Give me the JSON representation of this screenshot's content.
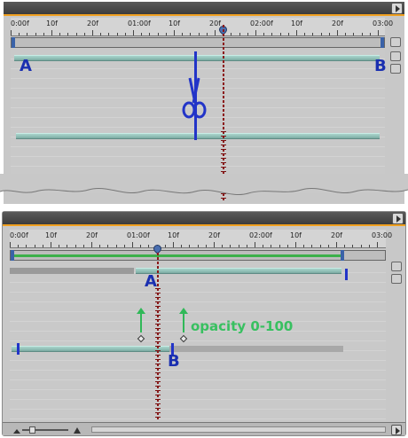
{
  "top_panel": {
    "ruler_ticks": [
      "0:00f",
      "10f",
      "20f",
      "01:00f",
      "10f",
      "20f",
      "02:00f",
      "10f",
      "20f",
      "03:00"
    ],
    "clip_start_label": "A",
    "clip_end_label": "B",
    "icons": [
      "scissors-icon"
    ]
  },
  "bottom_panel": {
    "ruler_ticks": [
      "0:00f",
      "10f",
      "20f",
      "01:00f",
      "10f",
      "20f",
      "02:00f",
      "10f",
      "20f",
      "03:00"
    ],
    "clip_a_label": "A",
    "clip_b_label": "B",
    "annotation": "opacity 0-100"
  },
  "colors": {
    "panel_bg": "#c8c8c8",
    "clip": "#8fbeb5",
    "playhead": "#8b1a1a",
    "label_blue": "#1a2fb0",
    "annotation_green": "#38c060",
    "accent_orange": "#f0a020"
  }
}
